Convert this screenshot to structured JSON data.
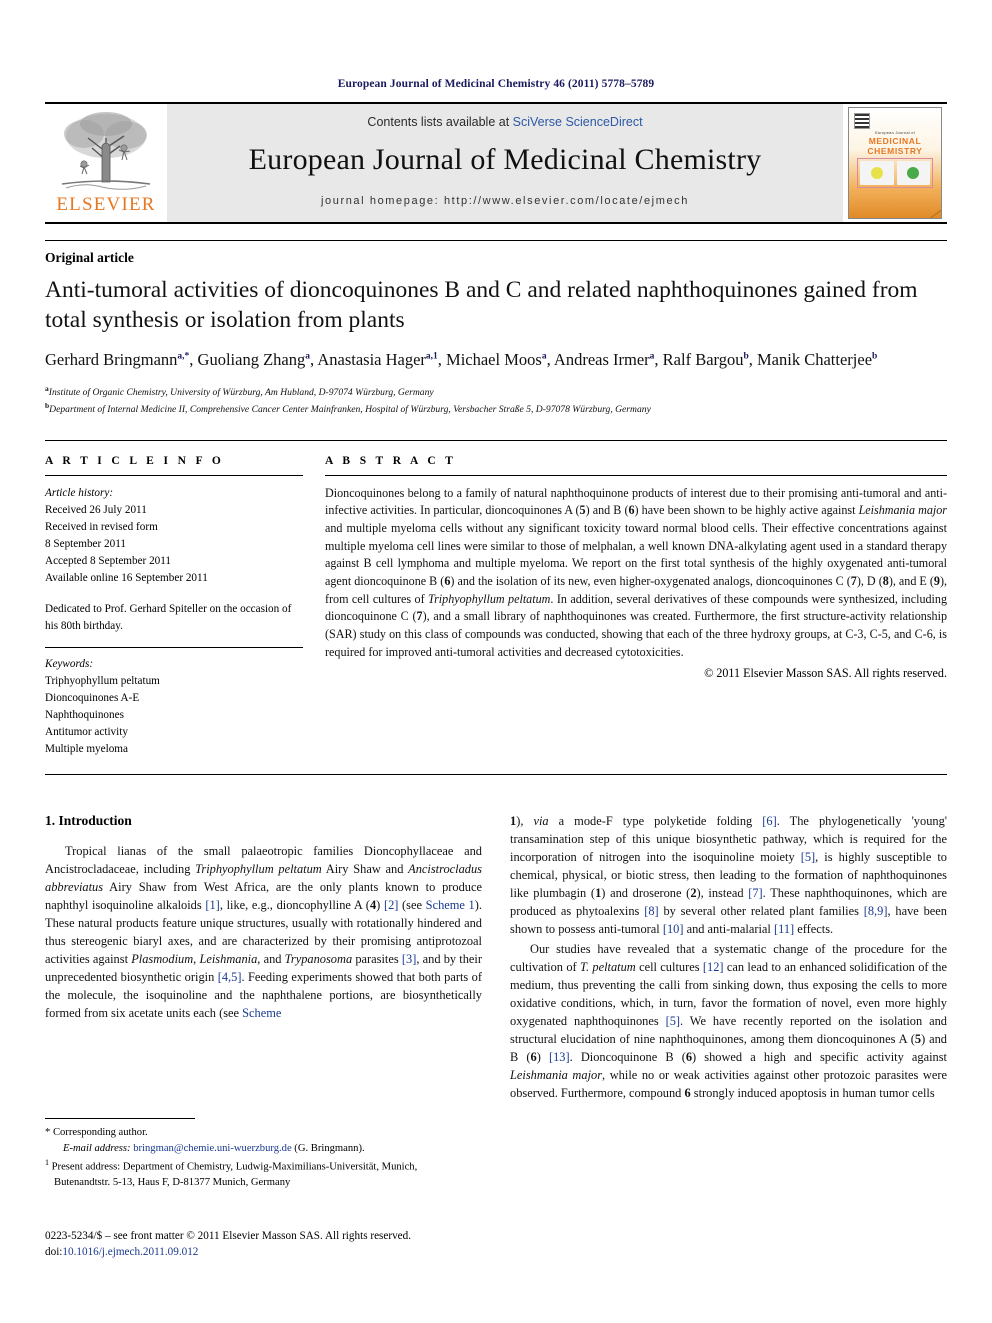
{
  "running_head": "European Journal of Medicinal Chemistry 46 (2011) 5778–5789",
  "masthead": {
    "publisher_name": "ELSEVIER",
    "contents_prefix": "Contents lists available at ",
    "contents_link": "SciVerse ScienceDirect",
    "journal_title": "European Journal of Medicinal Chemistry",
    "homepage": "journal homepage: http://www.elsevier.com/locate/ejmech",
    "cover": {
      "journal_small": "European Journal of",
      "title_line1": "MEDICINAL",
      "title_line2": "CHEMISTRY"
    }
  },
  "article": {
    "type": "Original article",
    "title": "Anti-tumoral activities of dioncoquinones B and C and related naphthoquinones gained from total synthesis or isolation from plants",
    "authors_html": "Gerhard Bringmann<sup>a,*</sup>, Guoliang Zhang<sup>a</sup>, Anastasia Hager<sup>a,1</sup>, Michael Moos<sup>a</sup>, Andreas Irmer<sup>a</sup>, Ralf Bargou<sup>b</sup>, Manik Chatterjee<sup>b</sup>",
    "affiliations": [
      {
        "marker": "a",
        "text": "Institute of Organic Chemistry, University of Würzburg, Am Hubland, D-97074 Würzburg, Germany"
      },
      {
        "marker": "b",
        "text": "Department of Internal Medicine II, Comprehensive Cancer Center Mainfranken, Hospital of Würzburg, Versbacher Straße 5, D-97078 Würzburg, Germany"
      }
    ]
  },
  "article_info": {
    "heading": "A R T I C L E   I N F O",
    "history_label": "Article history:",
    "history": [
      "Received 26 July 2011",
      "Received in revised form",
      "8 September 2011",
      "Accepted 8 September 2011",
      "Available online 16 September 2011"
    ],
    "dedication": "Dedicated to Prof. Gerhard Spiteller on the occasion of his 80th birthday.",
    "keywords_label": "Keywords:",
    "keywords": [
      "Triphyophyllum peltatum",
      "Dioncoquinones A-E",
      "Naphthoquinones",
      "Antitumor activity",
      "Multiple myeloma"
    ]
  },
  "abstract": {
    "heading": "A B S T R A C T",
    "text_html": "Dioncoquinones belong to a family of natural naphthoquinone products of interest due to their promising anti-tumoral and anti-infective activities. In particular, dioncoquinones A (<b>5</b>) and B (<b>6</b>) have been shown to be highly active against <i>Leishmania major</i> and multiple myeloma cells without any significant toxicity toward normal blood cells. Their effective concentrations against multiple myeloma cell lines were similar to those of melphalan, a well known DNA-alkylating agent used in a standard therapy against B cell lymphoma and multiple myeloma. We report on the first total synthesis of the highly oxygenated anti-tumoral agent dioncoquinone B (<b>6</b>) and the isolation of its new, even higher-oxygenated analogs, dioncoquinones C (<b>7</b>), D (<b>8</b>), and E (<b>9</b>), from cell cultures of <i>Triphyophyllum peltatum</i>. In addition, several derivatives of these compounds were synthesized, including dioncoquinone C (<b>7</b>), and a small library of naphthoquinones was created. Furthermore, the first structure-activity relationship (SAR) study on this class of compounds was conducted, showing that each of the three hydroxy groups, at C-3, C-5, and C-6, is required for improved anti-tumoral activities and decreased cytotoxicities.",
    "copyright": "© 2011 Elsevier Masson SAS. All rights reserved."
  },
  "body": {
    "section_number_title": "1. Introduction",
    "left_paragraph_html": "Tropical lianas of the small palaeotropic families Dioncophyllaceae and Ancistrocladaceae, including <i>Triphyophyllum peltatum</i> Airy Shaw and <i>Ancistrocladus abbreviatus</i> Airy Shaw from West Africa, are the only plants known to produce naphthyl isoquinoline alkaloids <span class=\"ref\">[1]</span>, like, e.g., dioncophylline A (<b>4</b>) <span class=\"ref\">[2]</span> (see <span class=\"ref\">Scheme 1</span>). These natural products feature unique structures, usually with rotationally hindered and thus stereogenic biaryl axes, and are characterized by their promising antiprotozoal activities against <i>Plasmodium</i>, <i>Leishmania</i>, and <i>Trypanosoma</i> parasites <span class=\"ref\">[3]</span>, and by their unprecedented biosynthetic origin <span class=\"ref\">[4,5]</span>. Feeding experiments showed that both parts of the molecule, the isoquinoline and the naphthalene portions, are biosynthetically formed from six acetate units each (see <span class=\"ref\">Scheme</span>",
    "right_paragraph1_html": "<b>1</b>), <i>via</i> a mode-F type polyketide folding <span class=\"ref\">[6]</span>. The phylogenetically 'young' transamination step of this unique biosynthetic pathway, which is required for the incorporation of nitrogen into the isoquinoline moiety <span class=\"ref\">[5]</span>, is highly susceptible to chemical, physical, or biotic stress, then leading to the formation of naphthoquinones like plumbagin (<b>1</b>) and droserone (<b>2</b>), instead <span class=\"ref\">[7]</span>. These naphthoquinones, which are produced as phytoalexins <span class=\"ref\">[8]</span> by several other related plant families <span class=\"ref\">[8,9]</span>, have been shown to possess anti-tumoral <span class=\"ref\">[10]</span> and anti-malarial <span class=\"ref\">[11]</span> effects.",
    "right_paragraph2_html": "Our studies have revealed that a systematic change of the procedure for the cultivation of <i>T. peltatum</i> cell cultures <span class=\"ref\">[12]</span> can lead to an enhanced solidification of the medium, thus preventing the calli from sinking down, thus exposing the cells to more oxidative conditions, which, in turn, favor the formation of novel, even more highly oxygenated naphthoquinones <span class=\"ref\">[5]</span>. We have recently reported on the isolation and structural elucidation of nine naphthoquinones, among them dioncoquinones A (<b>5</b>) and B (<b>6</b>) <span class=\"ref\">[13]</span>. Dioncoquinone B (<b>6</b>) showed a high and specific activity against <i>Leishmania major</i>, while no or weak activities against other protozoic parasites were observed. Furthermore, compound <b>6</b> strongly induced apoptosis in human tumor cells"
  },
  "footnotes": {
    "corresponding_html": "* Corresponding author.",
    "email_html": "<span class=\"it\">E-mail address:</span> <span class=\"mail\">bringman@chemie.uni-wuerzburg.de</span> (G. Bringmann).",
    "present_address_html": "<sup>1</sup> Present address: Department of Chemistry, Ludwig-Maximilians-Universität, Munich, Butenandtstr. 5-13, Haus F, D-81377 Munich, Germany"
  },
  "imprint": {
    "line1_html": "0223-5234/$ – see front matter © 2011 Elsevier Masson SAS. All rights reserved.",
    "doi_prefix": "doi:",
    "doi": "10.1016/j.ejmech.2011.09.012"
  },
  "colors": {
    "elsevier_orange": "#E87722",
    "link_blue": "#1a3a8f",
    "running_head_navy": "#1a1a5e",
    "masthead_grey": "#e8e8e8"
  }
}
